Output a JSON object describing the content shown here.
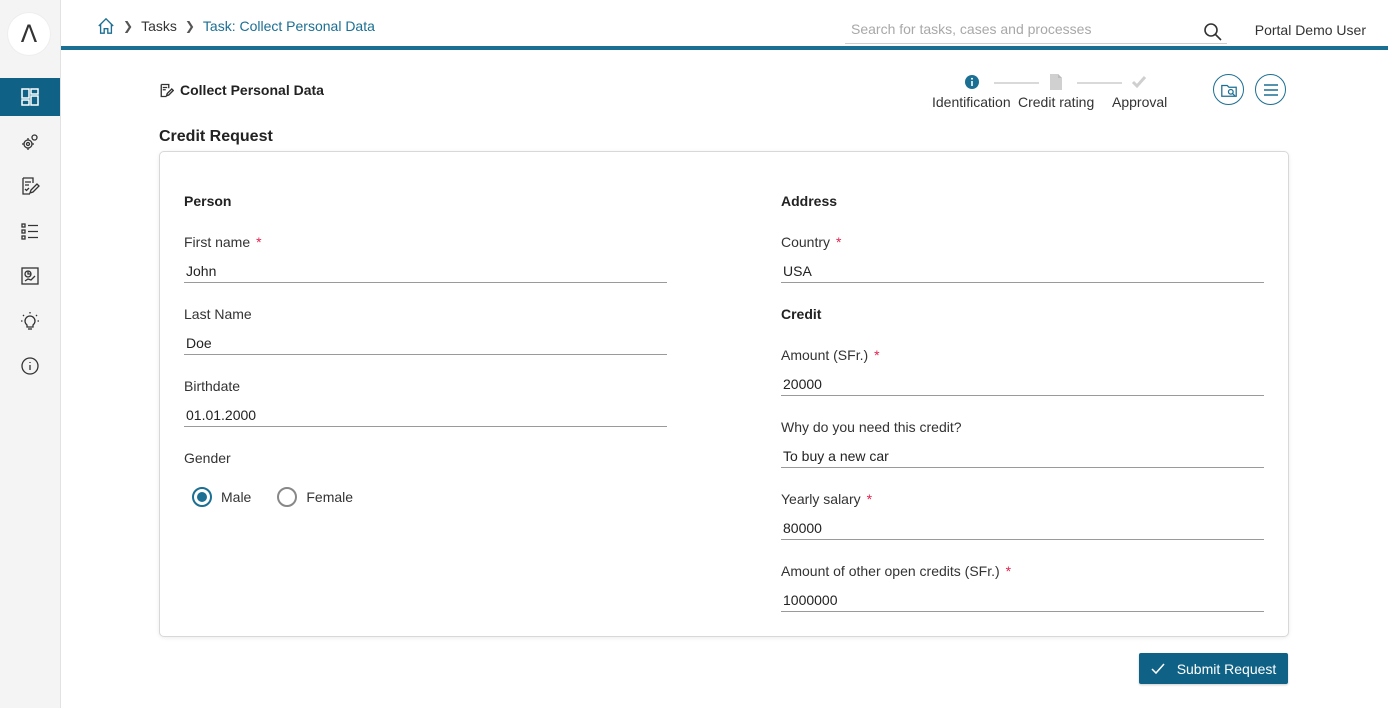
{
  "sidebar": {
    "logo_glyph": "Λ",
    "items": [
      {
        "icon": "dashboard-icon",
        "active": true
      },
      {
        "icon": "processes-gear-icon",
        "active": false
      },
      {
        "icon": "tasks-icon",
        "active": false
      },
      {
        "icon": "cases-list-icon",
        "active": false
      },
      {
        "icon": "statistics-icon",
        "active": false
      },
      {
        "icon": "ideas-bulb-icon",
        "active": false
      },
      {
        "icon": "info-icon",
        "active": false
      }
    ]
  },
  "topbar": {
    "home_icon": "home-icon",
    "breadcrumb": [
      "Tasks",
      "Task: Collect Personal Data"
    ],
    "search_placeholder": "Search for tasks, cases and processes",
    "user_name": "Portal Demo User",
    "accent_color": "#1b6f93"
  },
  "task": {
    "title": "Collect Personal Data",
    "steps": [
      {
        "label": "Identification",
        "icon": "info-icon",
        "state": "current"
      },
      {
        "label": "Credit rating",
        "icon": "document-icon",
        "state": "pending"
      },
      {
        "label": "Approval",
        "icon": "check-icon",
        "state": "pending"
      }
    ]
  },
  "form": {
    "heading": "Credit Request",
    "person": {
      "title": "Person",
      "first_name_label": "First name",
      "first_name_value": "John",
      "last_name_label": "Last Name",
      "last_name_value": "Doe",
      "birthdate_label": "Birthdate",
      "birthdate_value": "01.01.2000",
      "gender_label": "Gender",
      "gender_options": [
        "Male",
        "Female"
      ],
      "gender_selected": "Male"
    },
    "address": {
      "title": "Address",
      "country_label": "Country",
      "country_value": "USA"
    },
    "credit": {
      "title": "Credit",
      "amount_label": "Amount (SFr.)",
      "amount_value": "20000",
      "reason_label": "Why do you need this credit?",
      "reason_value": "To buy a new car",
      "salary_label": "Yearly salary",
      "salary_value": "80000",
      "other_credits_label": "Amount of other open credits (SFr.)",
      "other_credits_value": "1000000"
    },
    "required_marker": "*"
  },
  "actions": {
    "submit_label": "Submit Request"
  }
}
